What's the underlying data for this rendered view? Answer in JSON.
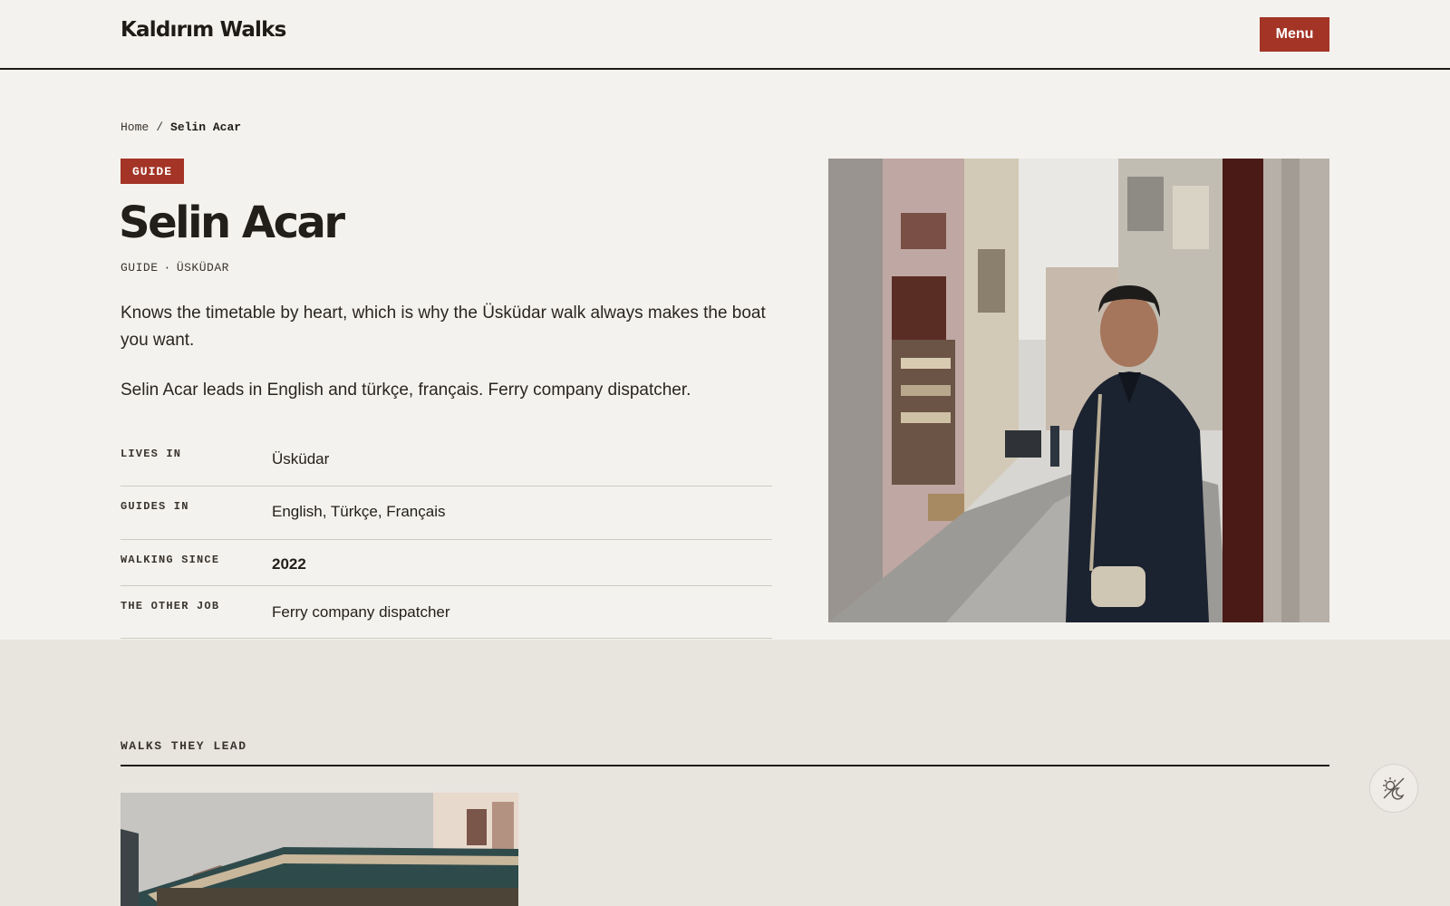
{
  "header": {
    "brand": "Kaldırım Walks",
    "menu_label": "Menu"
  },
  "breadcrumb": {
    "home": "Home",
    "separator": "/",
    "current": "Selin Acar"
  },
  "profile": {
    "badge": "GUIDE",
    "name": "Selin Acar",
    "meta_role": "GUIDE",
    "meta_dot": "·",
    "meta_place": "ÜSKÜDAR",
    "intro": "Knows the timetable by heart, which is why the Üsküdar walk always makes the boat you want.",
    "bio": "Selin Acar leads in English and türkçe, français. Ferry company dispatcher."
  },
  "facts": [
    {
      "label": "LIVES IN",
      "value": "Üsküdar"
    },
    {
      "label": "GUIDES IN",
      "value": "English, Türkçe, Français"
    },
    {
      "label": "WALKING SINCE",
      "value": "2022"
    },
    {
      "label": "THE OTHER JOB",
      "value": "Ferry company dispatcher"
    }
  ],
  "walks": {
    "heading": "WALKS THEY LEAD"
  },
  "icons": {
    "theme_toggle": "sun-moon-icon"
  },
  "colors": {
    "accent": "#a33426",
    "page_bg": "#f4f2ee",
    "section_bg": "#e8e4de",
    "ink": "#1f1b17"
  }
}
